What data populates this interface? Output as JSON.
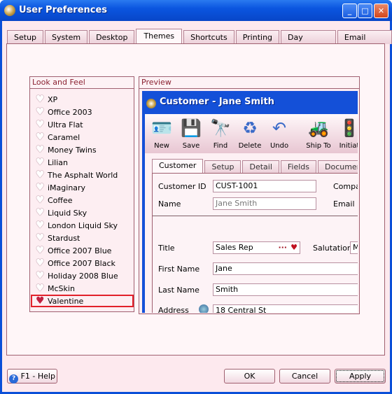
{
  "window": {
    "title": "User Preferences",
    "controls": {
      "minimize": "_",
      "maximize": "□",
      "close": "✕"
    }
  },
  "tabs": [
    {
      "label": "Setup"
    },
    {
      "label": "System"
    },
    {
      "label": "Desktop"
    },
    {
      "label": "Themes",
      "active": true
    },
    {
      "label": "Shortcuts"
    },
    {
      "label": "Printing"
    },
    {
      "label": "Day Planner"
    },
    {
      "label": "Email Setup"
    }
  ],
  "look_and_feel": {
    "header": "Look and Feel",
    "selected": "Valentine",
    "items": [
      "XP",
      "Office 2003",
      "Ultra Flat",
      "Caramel",
      "Money Twins",
      "Lilian",
      "The Asphalt World",
      "iMaginary",
      "Coffee",
      "Liquid Sky",
      "London Liquid Sky",
      "Stardust",
      "Office 2007 Blue",
      "Office 2007 Black",
      "Holiday 2008 Blue",
      "McSkin",
      "Valentine"
    ]
  },
  "preview": {
    "header": "Preview",
    "title": "Customer - Jane Smith",
    "toolbar": [
      {
        "label": "New",
        "icon": "new-contact-icon"
      },
      {
        "label": "Save",
        "icon": "floppy-icon"
      },
      {
        "label": "Find",
        "icon": "binoculars-icon"
      },
      {
        "label": "Delete",
        "icon": "recycle-bin-icon"
      },
      {
        "label": "Undo",
        "icon": "undo-arrow-icon"
      },
      {
        "label": "Ship To",
        "icon": "forklift-icon"
      },
      {
        "label": "Initiat",
        "icon": "traffic-light-icon"
      }
    ],
    "tabs": [
      "Customer",
      "Setup",
      "Detail",
      "Fields",
      "Documents"
    ],
    "fields": {
      "customer_id_label": "Customer ID",
      "customer_id": "CUST-1001",
      "company_label": "Compar",
      "name_label": "Name",
      "name": "Jane Smith",
      "email_label": "Email",
      "title_label": "Title",
      "title": "Sales Rep",
      "title_ellipsis": "···",
      "salutation_label": "Salutation",
      "salutation": "Mr",
      "first_name_label": "First Name",
      "first_name": "Jane",
      "last_name_label": "Last Name",
      "last_name": "Smith",
      "address_label": "Address",
      "address": "18 Central St"
    }
  },
  "buttons": {
    "help": "F1 - Help",
    "ok": "OK",
    "cancel": "Cancel",
    "apply": "Apply"
  },
  "colors": {
    "accent": "#a06070",
    "selection": "#e2202a",
    "titlebar": "#0a55e0"
  }
}
